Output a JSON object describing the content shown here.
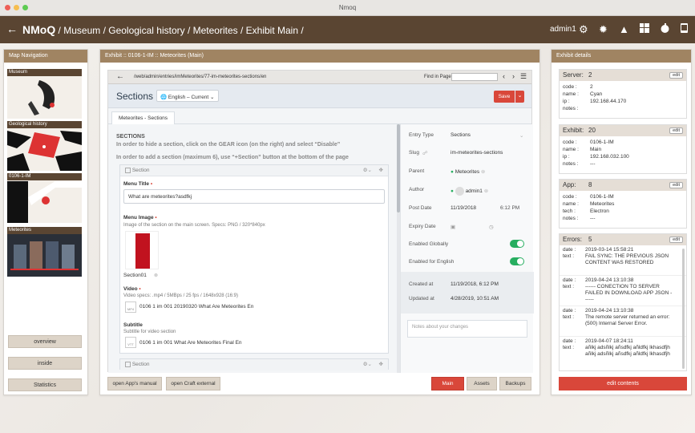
{
  "window": {
    "title": "Nmoq"
  },
  "header": {
    "brand": "NMoQ",
    "path": " / Museum / Geological history / Meteorites / Exhibit Main /",
    "user": "admin1",
    "icons": [
      "gear-icon",
      "bug-icon",
      "warning-icon",
      "windows-icon",
      "apple-icon",
      "phone-icon"
    ]
  },
  "map_nav": {
    "title": "Map Navigation",
    "maps": [
      {
        "label": "Museum"
      },
      {
        "label": "Geological history"
      },
      {
        "label": "0106-1-IM"
      },
      {
        "label": "Meteorites"
      }
    ],
    "buttons": [
      "overview",
      "inside",
      "Statistics"
    ]
  },
  "exhibit": {
    "title": "Exhibit :: 0106-1-IM :: Meteorites (Main)",
    "url": "/web/admin/entries/imMeteorites/77-im-meteorites-sections/en",
    "find_label": "Find in Page",
    "sections_title": "Sections",
    "site_select": "English – Current",
    "save_label": "Save",
    "tab": "Meteorites - Sections",
    "content": {
      "heading": "SECTIONS",
      "instr1": "In order to hide a section, click on the GEAR icon (on the right) and select “Disable”",
      "instr2": "In order to add a section (maximum 6), use “+Section” button at the bottom of the page",
      "block_label": "Section",
      "menu_title_label": "Menu Title",
      "menu_title_value": "What are meteorites?asdfkj",
      "menu_image_label": "Menu Image",
      "menu_image_note": "Image of the section on the main screen. Specs: PNG / 320*840px",
      "image_name": "Section01",
      "video_label": "Video",
      "video_note": "Video specs: .mp4 / 5MBps / 25 fps / 1648x928 (16:9)",
      "video_file": "0106 1 im 001 20190320 What Are Meteorites En",
      "video_type": "MP4",
      "subtitle_label": "Subtitle",
      "subtitle_note": "Subtitle for video section",
      "subtitle_file": "0106 1 im 001 What Are Meteorites Final En",
      "subtitle_type": "VTT",
      "block2_label": "Section"
    },
    "meta": [
      {
        "k": "Entry Type",
        "v": "Sections"
      },
      {
        "k": "Slug",
        "v": "im-meteorites-sections"
      },
      {
        "k": "Parent",
        "v": "Meteorites"
      },
      {
        "k": "Author",
        "v": "admin1"
      },
      {
        "k": "Post Date",
        "v": "11/19/2018",
        "v2": "6:12 PM"
      },
      {
        "k": "Expiry Date",
        "v": ""
      },
      {
        "k": "Enabled Globally",
        "v": ""
      },
      {
        "k": "Enabled for English",
        "v": ""
      }
    ],
    "created": {
      "k": "Created at",
      "v": "11/19/2018, 6:12 PM"
    },
    "updated": {
      "k": "Updated at",
      "v": "4/28/2019, 10:51 AM"
    },
    "notes_placeholder": "Notes about your changes",
    "buttons": {
      "manual": "open App's manual",
      "craft": "open Craft external",
      "main": "Main",
      "assets": "Assets",
      "backups": "Backups"
    }
  },
  "details": {
    "title": "Exhibit details",
    "edit": "edit",
    "server": {
      "label": "Server:",
      "value": "2",
      "rows": [
        [
          "code :",
          "2"
        ],
        [
          "name :",
          "Cyan"
        ],
        [
          "ip :",
          "192.168.44.170"
        ],
        [
          "notes :",
          ""
        ]
      ]
    },
    "exhibit": {
      "label": "Exhibit:",
      "value": "20",
      "rows": [
        [
          "code :",
          "0106-1-IM"
        ],
        [
          "name :",
          "Main"
        ],
        [
          "ip :",
          "192.168.032.100"
        ],
        [
          "notes :",
          "---"
        ]
      ]
    },
    "app": {
      "label": "App:",
      "value": "8",
      "rows": [
        [
          "code :",
          "0106-1-IM"
        ],
        [
          "name :",
          "Meteorites"
        ],
        [
          "tech :",
          "Electron"
        ],
        [
          "notes :",
          "---"
        ]
      ]
    },
    "errors": {
      "label": "Errors:",
      "value": "5",
      "items": [
        {
          "date": "2019-03-14 15:58:21",
          "text": "FAIL SYNC: THE PREVIOUS JSON CONTENT WAS RESTORED"
        },
        {
          "date": "2019-04-24 13:10:38",
          "text": "------ CONECTION TO SERVER FAILED IN DOWNLOAD APP JSON ------"
        },
        {
          "date": "2019-04-24 13:10:38",
          "text": "The remote server returned an error: (500) Internal Server Error."
        },
        {
          "date": "2019-04-07 18:24:11",
          "text": "añlkj adsñlkj añsdfkj añldfkj lkhasdfjh añlkj adsñlkj añsdfkj añldfkj lkhasdfjh"
        }
      ]
    },
    "edit_contents": "edit contents"
  },
  "colors": {
    "header": "#5a4532",
    "panel_head": "#a08462",
    "accent_red": "#d9473a",
    "toggle_green": "#27ae60"
  }
}
